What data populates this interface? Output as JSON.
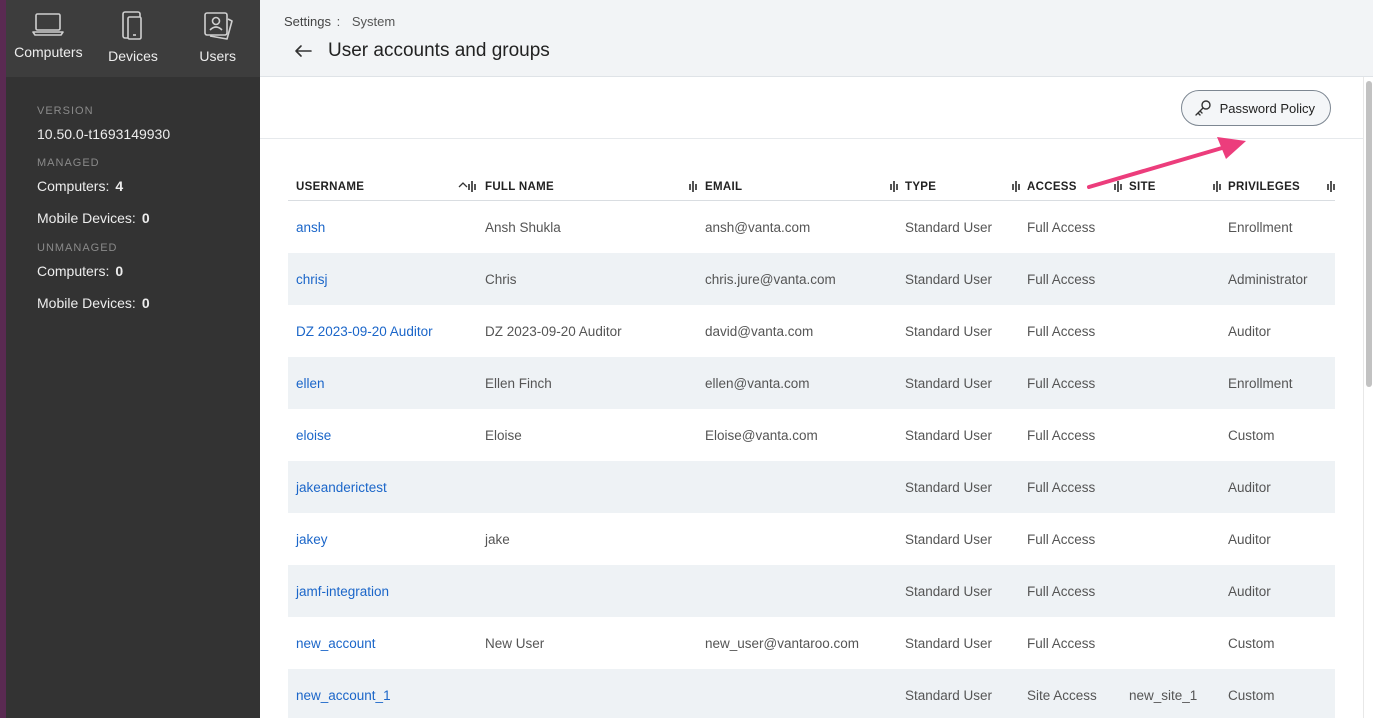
{
  "nav": {
    "items": [
      {
        "label": "Computers",
        "icon": "laptop-icon"
      },
      {
        "label": "Devices",
        "icon": "mobile-device-icon"
      },
      {
        "label": "Users",
        "icon": "user-card-icon"
      }
    ]
  },
  "sidebar": {
    "version_label": "VERSION",
    "version_value": "10.50.0-t1693149930",
    "managed_label": "MANAGED",
    "managed": [
      {
        "label": "Computers:",
        "count": "4"
      },
      {
        "label": "Mobile Devices:",
        "count": "0"
      }
    ],
    "unmanaged_label": "UNMANAGED",
    "unmanaged": [
      {
        "label": "Computers:",
        "count": "0"
      },
      {
        "label": "Mobile Devices:",
        "count": "0"
      }
    ]
  },
  "header": {
    "breadcrumb_root": "Settings",
    "breadcrumb_sep": ":",
    "breadcrumb_current": "System",
    "title": "User accounts and groups"
  },
  "toolbar": {
    "password_policy_label": "Password Policy",
    "password_policy_icon": "key-icon"
  },
  "table": {
    "columns": [
      "USERNAME",
      "FULL NAME",
      "EMAIL",
      "TYPE",
      "ACCESS",
      "SITE",
      "PRIVILEGES"
    ],
    "sort_column": "USERNAME",
    "rows": [
      {
        "username": "ansh",
        "full_name": "Ansh Shukla",
        "email": "ansh@vanta.com",
        "type": "Standard User",
        "access": "Full Access",
        "site": "",
        "privileges": "Enrollment"
      },
      {
        "username": "chrisj",
        "full_name": "Chris",
        "email": "chris.jure@vanta.com",
        "type": "Standard User",
        "access": "Full Access",
        "site": "",
        "privileges": "Administrator"
      },
      {
        "username": "DZ 2023-09-20 Auditor",
        "full_name": "DZ 2023-09-20 Auditor",
        "email": "david@vanta.com",
        "type": "Standard User",
        "access": "Full Access",
        "site": "",
        "privileges": "Auditor"
      },
      {
        "username": "ellen",
        "full_name": "Ellen Finch",
        "email": "ellen@vanta.com",
        "type": "Standard User",
        "access": "Full Access",
        "site": "",
        "privileges": "Enrollment"
      },
      {
        "username": "eloise",
        "full_name": "Eloise",
        "email": "Eloise@vanta.com",
        "type": "Standard User",
        "access": "Full Access",
        "site": "",
        "privileges": "Custom"
      },
      {
        "username": "jakeanderictest",
        "full_name": "",
        "email": "",
        "type": "Standard User",
        "access": "Full Access",
        "site": "",
        "privileges": "Auditor"
      },
      {
        "username": "jakey",
        "full_name": "jake",
        "email": "",
        "type": "Standard User",
        "access": "Full Access",
        "site": "",
        "privileges": "Auditor"
      },
      {
        "username": "jamf-integration",
        "full_name": "",
        "email": "",
        "type": "Standard User",
        "access": "Full Access",
        "site": "",
        "privileges": "Auditor"
      },
      {
        "username": "new_account",
        "full_name": "New User",
        "email": "new_user@vantaroo.com",
        "type": "Standard User",
        "access": "Full Access",
        "site": "",
        "privileges": "Custom"
      },
      {
        "username": "new_account_1",
        "full_name": "",
        "email": "",
        "type": "Standard User",
        "access": "Site Access",
        "site": "new_site_1",
        "privileges": "Custom"
      }
    ]
  },
  "colors": {
    "sidebar_bg": "#333333",
    "link": "#1b66c9",
    "row_alt": "#eef2f5",
    "annotation_arrow": "#ec3d7c"
  }
}
